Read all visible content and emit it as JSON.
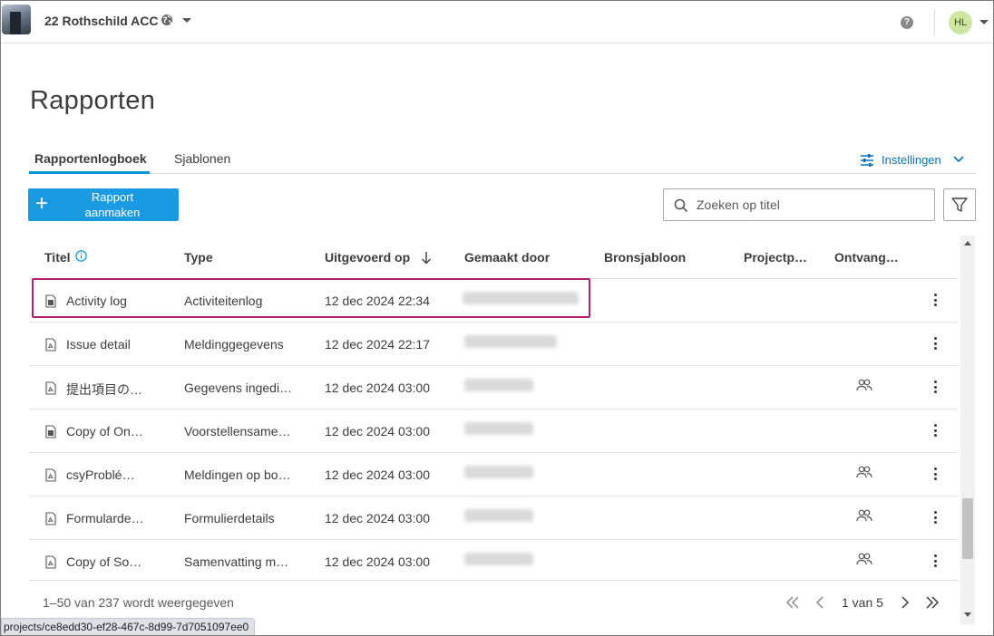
{
  "header": {
    "project_name": "22 Rothschild ACC",
    "avatar_initials": "HL",
    "help_glyph": "?"
  },
  "page": {
    "title": "Rapporten"
  },
  "tabs": [
    {
      "label": "Rapportenlogboek",
      "active": true
    },
    {
      "label": "Sjablonen",
      "active": false
    }
  ],
  "settings_label": "Instellingen",
  "toolbar": {
    "create_label": "Rapport aanmaken",
    "create_plus": "+",
    "search_placeholder": "Zoeken op titel"
  },
  "table": {
    "columns": [
      "Titel",
      "Type",
      "Uitgevoerd op",
      "Gemaakt door",
      "Bronsjabloon",
      "Projectp…",
      "Ontvang…"
    ],
    "sort_column": "Uitgevoerd op",
    "sort_direction": "descending",
    "rows": [
      {
        "title": "Activity log",
        "type": "Activiteitenlog",
        "date": "12 dec 2024 22:34",
        "icon": "document-icon",
        "recipients": false,
        "highlighted": true
      },
      {
        "title": "Issue detail",
        "type": "Meldinggegevens",
        "date": "12 dec 2024 22:17",
        "icon": "pdf-document-icon",
        "recipients": false,
        "highlighted": false
      },
      {
        "title": "提出項目の…",
        "type": "Gegevens ingedi…",
        "date": "12 dec 2024 03:00",
        "icon": "pdf-document-icon",
        "recipients": true,
        "highlighted": false
      },
      {
        "title": "Copy of On…",
        "type": "Voorstellensame…",
        "date": "12 dec 2024 03:00",
        "icon": "document-icon",
        "recipients": false,
        "highlighted": false
      },
      {
        "title": "csyProblé…",
        "type": "Meldingen op bo…",
        "date": "12 dec 2024 03:00",
        "icon": "pdf-document-icon",
        "recipients": true,
        "highlighted": false
      },
      {
        "title": "Formularde…",
        "type": "Formulierdetails",
        "date": "12 dec 2024 03:00",
        "icon": "pdf-document-icon",
        "recipients": true,
        "highlighted": false
      },
      {
        "title": "Copy of So…",
        "type": "Samenvatting m…",
        "date": "12 dec 2024 03:00",
        "icon": "pdf-document-icon",
        "recipients": true,
        "highlighted": false
      }
    ]
  },
  "footer": {
    "range_text": "1–50 van 237 wordt weergegeven",
    "page_text": "1 van 5"
  },
  "status_url": "projects/ce8edd30-ef28-467c-8d99-7d7051097ee0",
  "colors": {
    "accent": "#0696d7",
    "primary_button": "#1a9ae0",
    "highlight_border": "#b0206e",
    "avatar_bg": "#cfe6a3"
  }
}
